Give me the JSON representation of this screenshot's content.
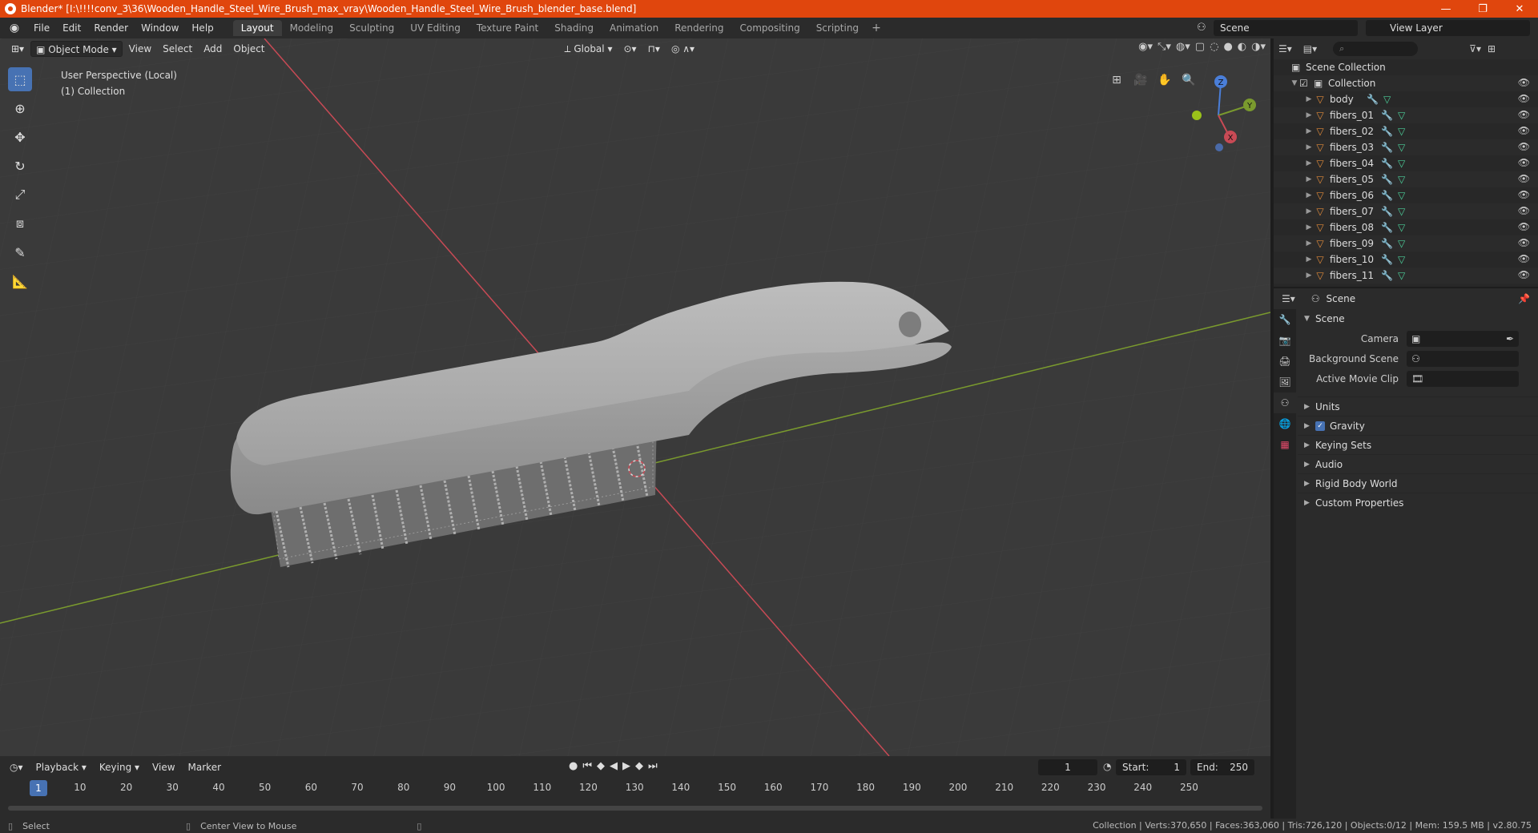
{
  "window": {
    "title": "Blender* [I:\\!!!!conv_3\\36\\Wooden_Handle_Steel_Wire_Brush_max_vray\\Wooden_Handle_Steel_Wire_Brush_blender_base.blend]",
    "minimize": "—",
    "maximize": "❐",
    "close": "✕"
  },
  "menu": {
    "items": [
      "File",
      "Edit",
      "Render",
      "Window",
      "Help"
    ]
  },
  "workspaces": [
    "Layout",
    "Modeling",
    "Sculpting",
    "UV Editing",
    "Texture Paint",
    "Shading",
    "Animation",
    "Rendering",
    "Compositing",
    "Scripting"
  ],
  "scene_selector": "Scene",
  "view_layer": "View Layer",
  "viewport": {
    "mode": "Object Mode",
    "menus": [
      "View",
      "Select",
      "Add",
      "Object"
    ],
    "transform_orientation": "Global",
    "info_line1": "User Perspective (Local)",
    "info_line2": "(1) Collection",
    "gizmo": {
      "x": "X",
      "y": "Y",
      "z": "Z"
    }
  },
  "timeline": {
    "menus": [
      "Playback",
      "Keying",
      "View",
      "Marker"
    ],
    "current_frame": "1",
    "start_label": "Start:",
    "start": "1",
    "end_label": "End:",
    "end": "250",
    "ticks": [
      1,
      10,
      20,
      30,
      40,
      50,
      60,
      70,
      80,
      90,
      100,
      110,
      120,
      130,
      140,
      150,
      160,
      170,
      180,
      190,
      200,
      210,
      220,
      230,
      240,
      250
    ]
  },
  "statusbar": {
    "left1": "Select",
    "left2": "Center View to Mouse",
    "right": "Collection | Verts:370,650 | Faces:363,060 | Tris:726,120 | Objects:0/12 | Mem: 159.5 MB | v2.80.75"
  },
  "outliner": {
    "search_placeholder": "",
    "scene_collection": "Scene Collection",
    "collection": "Collection",
    "objects": [
      "body",
      "fibers_01",
      "fibers_02",
      "fibers_03",
      "fibers_04",
      "fibers_05",
      "fibers_06",
      "fibers_07",
      "fibers_08",
      "fibers_09",
      "fibers_10",
      "fibers_11"
    ]
  },
  "properties": {
    "header": "Scene",
    "panel": "Scene",
    "camera_label": "Camera",
    "background_scene_label": "Background Scene",
    "active_movie_clip_label": "Active Movie Clip",
    "subpanels": [
      "Units",
      "Gravity",
      "Keying Sets",
      "Audio",
      "Rigid Body World",
      "Custom Properties"
    ]
  },
  "colors": {
    "titlebar": "#e0460d",
    "accent": "#4772b3",
    "mesh_icon": "#e08a3a",
    "x_axis": "#c84a55",
    "y_axis": "#7a9a2e"
  }
}
